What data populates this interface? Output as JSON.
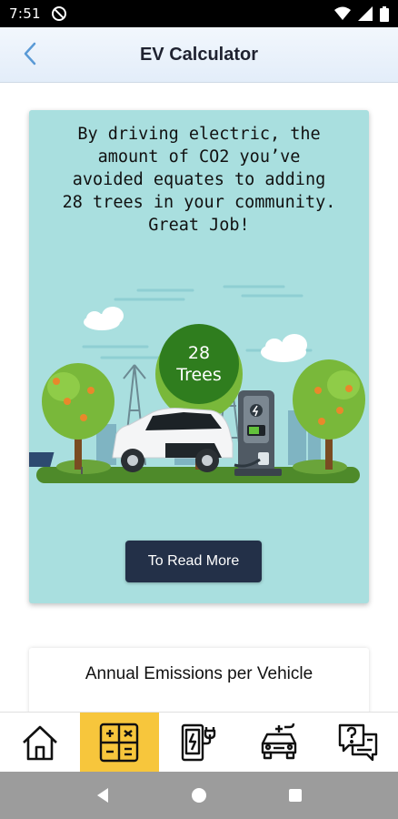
{
  "status_bar": {
    "time": "7:51"
  },
  "header": {
    "title": "EV Calculator"
  },
  "hero": {
    "message_lines": [
      "By driving electric, the",
      "amount of CO2 you’ve",
      "avoided equates to adding",
      "28 trees in your community.",
      "Great Job!"
    ],
    "trees_count": "28",
    "trees_unit": "Trees",
    "read_more_label": "To Read More",
    "card_color": "#a9dfdf",
    "button_color": "#233048",
    "badge_color": "#2f7d1e"
  },
  "emissions_card": {
    "title": "Annual Emissions per Vehicle"
  },
  "bottom_nav": {
    "items": [
      {
        "icon": "home-icon",
        "active": false
      },
      {
        "icon": "calculator-icon",
        "active": true
      },
      {
        "icon": "charging-station-icon",
        "active": false
      },
      {
        "icon": "electric-car-icon",
        "active": false
      },
      {
        "icon": "help-chat-icon",
        "active": false
      }
    ],
    "active_color": "#f7c63c"
  },
  "system_nav": {
    "icons": [
      "back-icon",
      "home-circle-icon",
      "recents-icon"
    ]
  }
}
